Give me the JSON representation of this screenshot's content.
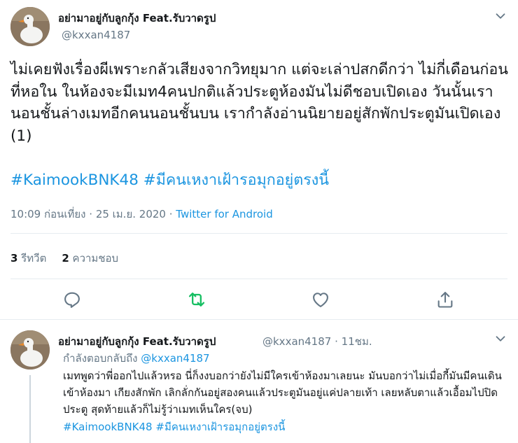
{
  "main_tweet": {
    "author_name": "อย่ามาอยู่กับลูกกุ้ง Feat.รับวาดรูป",
    "author_handle": "@kxxan4187",
    "text": "ไม่เคยฟังเรื่องผีเพราะกลัวเสียงจากวิทยุมาก แต่จะเล่าปสกดีกว่า ไม่กี่เดือนก่อนที่หอใน ในห้องจะมีเมท4คนปกติแล้วประตูห้องมันไม่ดีชอบเปิดเอง วันนั้นเรานอนชั้นล่างเมทอีกคนนอนชั้นบน เรากำลังอ่านนิยายอยู่สักพักประตูมันเปิดเอง (1)",
    "hashtags": [
      "#KaimookBNK48",
      "#มีคนเหงาเฝ้ารอมุกอยู่ตรงนี้"
    ],
    "time": "10:09 ก่อนเที่ยง",
    "separator": "·",
    "date": "25 เม.ย. 2020",
    "source": "Twitter for Android",
    "retweet_count": "3",
    "retweet_label": "รีทวีต",
    "like_count": "2",
    "like_label": "ความชอบ"
  },
  "actions": {
    "reply_icon": "reply-icon",
    "retweet_icon": "retweet-icon",
    "like_icon": "heart-icon",
    "share_icon": "share-icon",
    "retweet_color": "#17bf63"
  },
  "reply_tweet": {
    "author_name": "อย่ามาอยู่กับลูกกุ้ง Feat.รับวาดรูป",
    "author_handle": "@kxxan4187",
    "separator": "·",
    "time_ago": "11ชม.",
    "replying_label": "กำลังตอบกลับถึง",
    "replying_to": "@kxxan4187",
    "text": "เมทพูดว่าพี่ออกไปแล้วหรอ นี่ก็งงบอกว่ายังไม่มีใครเข้าห้องมาเลยนะ มันบอกว่าไม่เมื่อกี้มันมีคนเดินเข้าห้องมา เกียงสักพัก เลิกลั่กกันอยู่สองคนแล้วประตูมันอยู่แค่ปลายเท้า เลยหลับตาแล้วเอื้อมไปปิดประตู สุดท้ายแล้วก็ไม่รู้ว่าเมทเห็นใคร(จบ)",
    "hashtags": [
      "#KaimookBNK48",
      "#มีคนเหงาเฝ้ารอมุกอยู่ตรงนี้"
    ]
  },
  "colors": {
    "link": "#1b95e0",
    "secondary_text": "#657786",
    "divider": "#e6ecf0"
  }
}
